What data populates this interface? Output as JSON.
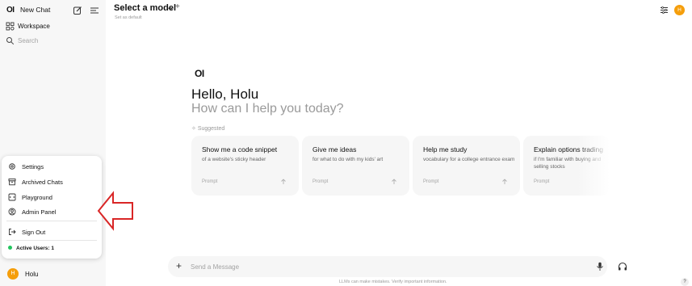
{
  "sidebar": {
    "logo": "OI",
    "new_chat": "New Chat",
    "workspace": "Workspace",
    "search_placeholder": "Search",
    "menu": {
      "settings": "Settings",
      "archived_chats": "Archived Chats",
      "playground": "Playground",
      "admin_panel": "Admin Panel",
      "sign_out": "Sign Out",
      "active_users": "Active Users: 1"
    },
    "user": {
      "initial": "H",
      "name": "Holu"
    }
  },
  "header": {
    "model_title": "Select a model",
    "plus": "+",
    "set_default": "Set as default",
    "avatar_initial": "H"
  },
  "main": {
    "logo": "OI",
    "greeting": "Hello, Holu",
    "subtitle": "How can I help you today?",
    "suggested_label": "Suggested",
    "suggestions": [
      {
        "title": "Show me a code snippet",
        "description": "of a website's sticky header",
        "prompt_label": "Prompt"
      },
      {
        "title": "Give me ideas",
        "description": "for what to do with my kids' art",
        "prompt_label": "Prompt"
      },
      {
        "title": "Help me study",
        "description": "vocabulary for a college entrance exam",
        "prompt_label": "Prompt"
      },
      {
        "title": "Explain options trading",
        "description": "if I'm familiar with buying and selling stocks",
        "prompt_label": "Prompt"
      }
    ]
  },
  "input": {
    "placeholder": "Send a Message",
    "plus": "+",
    "disclaimer": "LLMs can make mistakes. Verify important information.",
    "help": "?"
  },
  "colors": {
    "accent_avatar": "#f59e0b",
    "active_dot": "#22c55e",
    "arrow": "#d92626"
  }
}
